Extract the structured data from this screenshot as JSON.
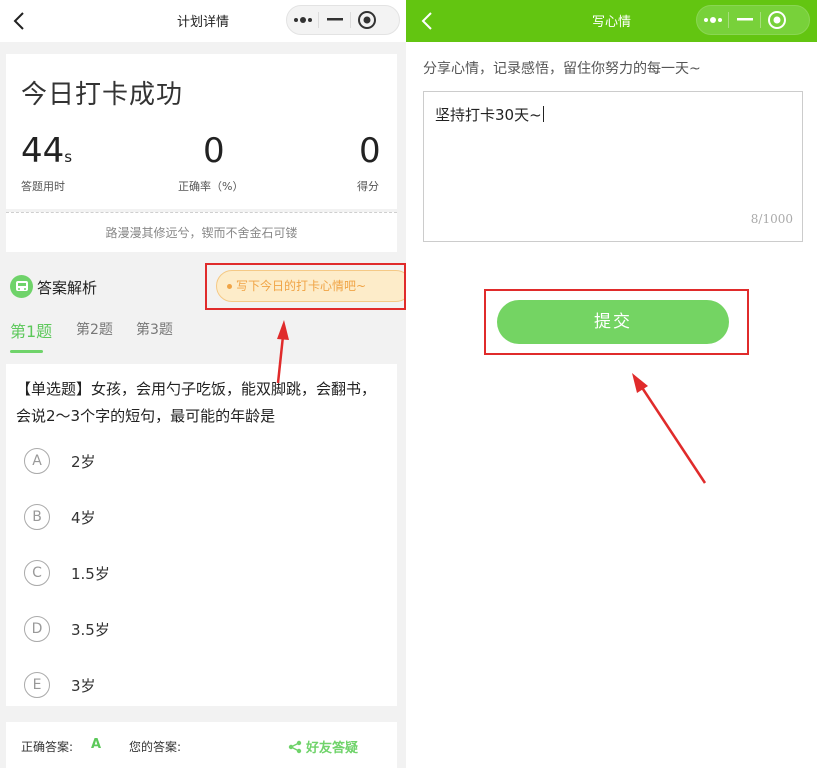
{
  "left": {
    "nav": {
      "title": "计划详情"
    },
    "summary": {
      "title": "今日打卡成功",
      "stats": [
        {
          "value": "44",
          "unit": "s",
          "label": "答题用时"
        },
        {
          "value": "0",
          "label": "正确率（%）"
        },
        {
          "value": "0",
          "label": "得分"
        }
      ],
      "quote": "路漫漫其修远兮，锲而不舍金石可镂"
    },
    "analysis": {
      "title": "答案解析",
      "mood_prompt": "写下今日的打卡心情吧~"
    },
    "tabs": [
      "第1题",
      "第2题",
      "第3题"
    ],
    "active_tab": 0,
    "question": {
      "text": "【单选题】女孩，会用勺子吃饭，能双脚跳，会翻书，会说2～3个字的短句，最可能的年龄是",
      "options": [
        {
          "letter": "A",
          "text": "2岁"
        },
        {
          "letter": "B",
          "text": "4岁"
        },
        {
          "letter": "C",
          "text": "1.5岁"
        },
        {
          "letter": "D",
          "text": "3.5岁"
        },
        {
          "letter": "E",
          "text": "3岁"
        }
      ]
    },
    "footer": {
      "correct_label": "正确答案:",
      "correct_value": "A",
      "your_label": "您的答案:",
      "your_value": "",
      "share_label": "好友答疑"
    }
  },
  "right": {
    "nav": {
      "title": "写心情"
    },
    "prompt": "分享心情，记录感悟，留住你努力的每一天~",
    "textarea": {
      "value": "坚持打卡30天~",
      "counter": "8/1000"
    },
    "submit_label": "提交"
  },
  "colors": {
    "brand_green": "#63c511",
    "accent_green": "#6fd36a",
    "highlight_red": "#e02b2b",
    "mood_orange": "#f0a446"
  }
}
